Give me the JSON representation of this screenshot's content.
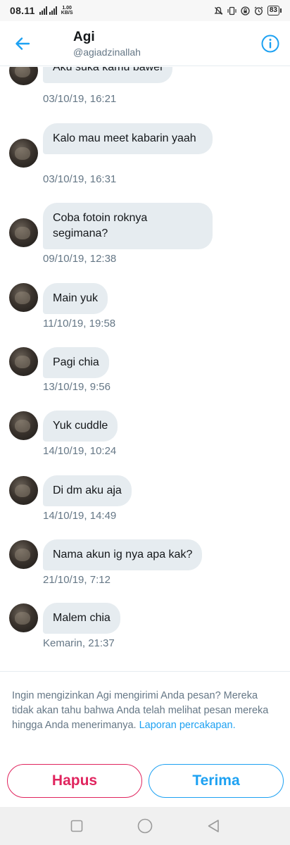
{
  "status_bar": {
    "time": "08.11",
    "net_speed_value": "1.00",
    "net_speed_unit": "KB/S",
    "battery": "83",
    "icons": [
      "signal-icon",
      "wifi-icon",
      "silent-icon",
      "vibrate-icon",
      "lock-icon",
      "alarm-icon",
      "battery-icon"
    ]
  },
  "header": {
    "name": "Agi",
    "handle": "@agiadzinallah",
    "back_icon": "arrow-left-icon",
    "info_icon": "info-icon",
    "accent": "#1da1f2"
  },
  "messages": [
    {
      "text": "Aku suka kamu bawel",
      "time": "03/10/19, 16:21"
    },
    {
      "text": "Kalo mau meet kabarin yaah",
      "time": "03/10/19, 16:31"
    },
    {
      "text": "Coba fotoin roknya segimana?",
      "time": "09/10/19, 12:38"
    },
    {
      "text": "Main yuk",
      "time": "11/10/19, 19:58"
    },
    {
      "text": "Pagi chia",
      "time": "13/10/19, 9:56"
    },
    {
      "text": "Yuk cuddle",
      "time": "14/10/19, 10:24"
    },
    {
      "text": "Di dm aku aja",
      "time": "14/10/19, 14:49"
    },
    {
      "text": "Nama akun ig nya apa kak?",
      "time": "21/10/19, 7:12"
    },
    {
      "text": "Malem chia",
      "time": "Kemarin, 21:37"
    }
  ],
  "request": {
    "text": "Ingin mengizinkan Agi mengirimi Anda pesan? Mereka tidak akan tahu bahwa Anda telah melihat pesan mereka hingga Anda menerimanya.",
    "link": "Laporan percakapan.",
    "delete_label": "Hapus",
    "accept_label": "Terima",
    "delete_color": "#e0245e",
    "accept_color": "#1da1f2"
  },
  "navbar": {
    "icons": [
      "recents-icon",
      "home-icon",
      "back-icon"
    ]
  }
}
